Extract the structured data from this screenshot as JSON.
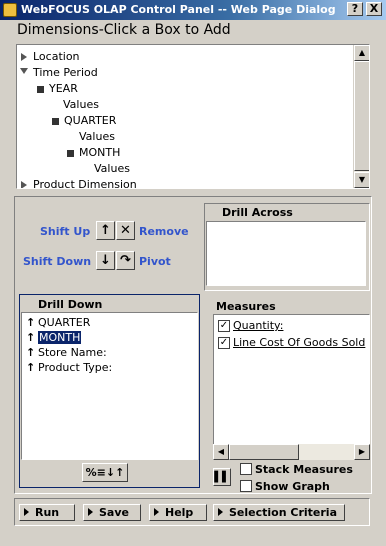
{
  "window": {
    "title": "WebFOCUS OLAP Control Panel -- Web Page Dialog",
    "help_label": "?",
    "close_label": "X"
  },
  "dimensions": {
    "title": "Dimensions-Click a Box to Add",
    "tree": {
      "location": "Location",
      "time_period": "Time Period",
      "year": "YEAR",
      "year_values": "Values",
      "quarter": "QUARTER",
      "quarter_values": "Values",
      "month": "MONTH",
      "month_values": "Values",
      "product_dimension": "Product Dimension"
    }
  },
  "controls": {
    "shift_up": "Shift Up",
    "remove": "Remove",
    "shift_down": "Shift Down",
    "pivot": "Pivot"
  },
  "drill_across": {
    "title": "Drill Across"
  },
  "drill_down": {
    "title": "Drill Down",
    "items": [
      "QUARTER",
      "MONTH",
      "Store Name:",
      "Product Type:"
    ],
    "selected_index": 1,
    "sort_button": "%≡↓↑"
  },
  "measures": {
    "title": "Measures",
    "items": [
      {
        "label": "Quantity:",
        "checked": true
      },
      {
        "label": "Line Cost Of Goods Sold",
        "checked": true
      }
    ]
  },
  "options": {
    "stack_measures": "Stack Measures",
    "show_graph": "Show Graph"
  },
  "actions": {
    "run": "Run",
    "save": "Save",
    "help": "Help",
    "selection_criteria": "Selection Criteria"
  }
}
